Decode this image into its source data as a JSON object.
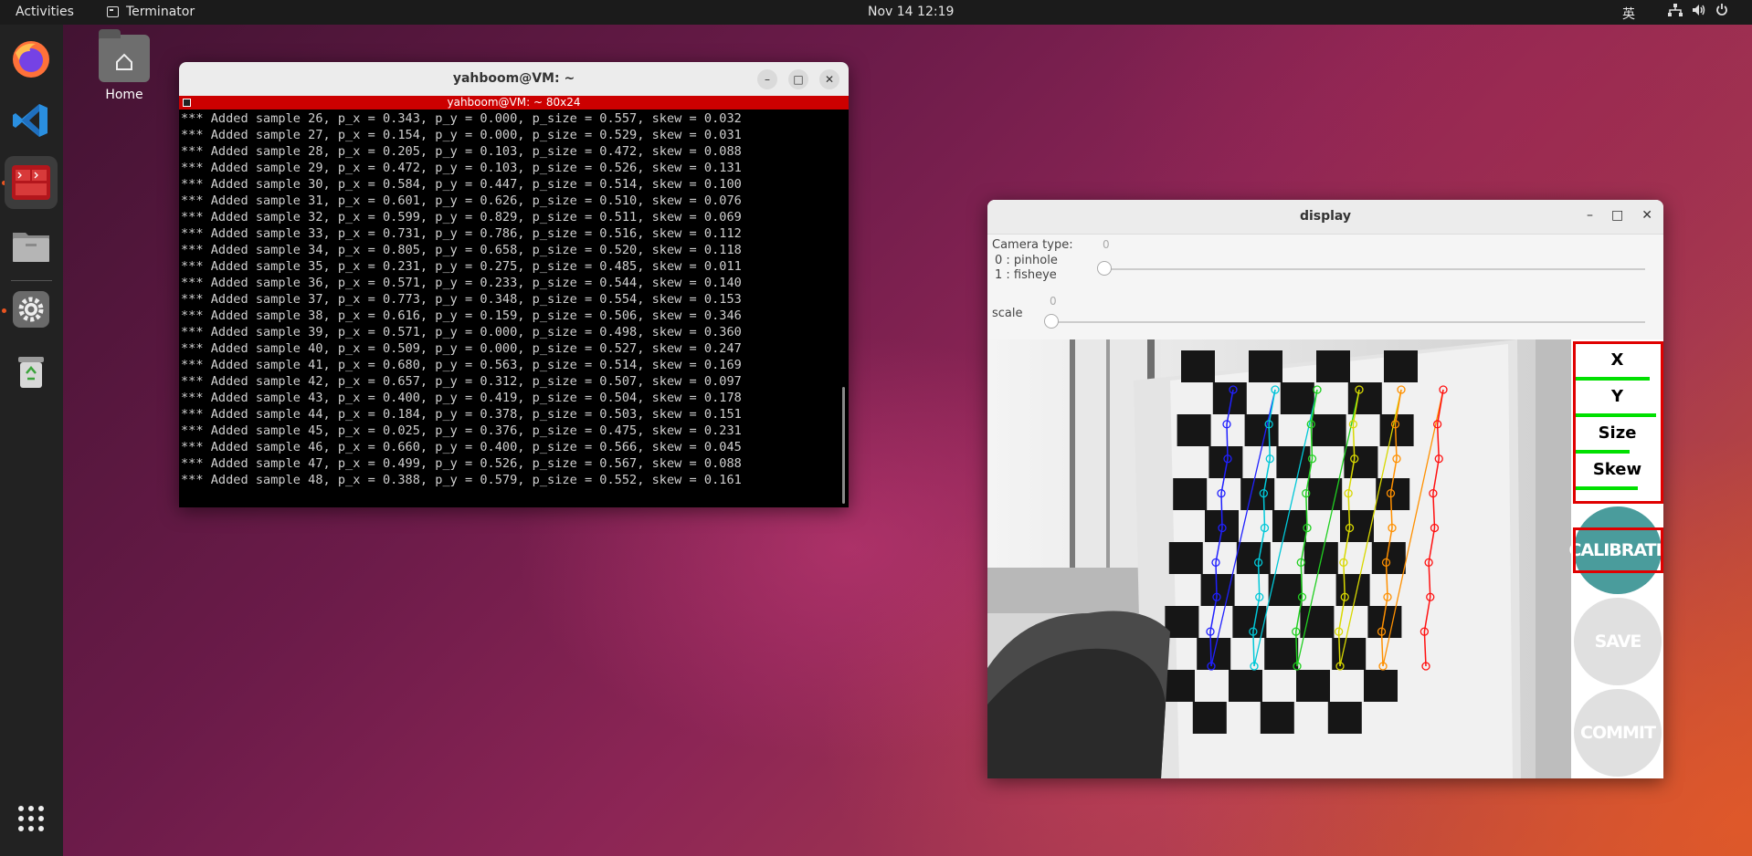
{
  "topbar": {
    "activities": "Activities",
    "app_name": "Terminator",
    "clock": "Nov 14  12:19",
    "ime": "英"
  },
  "dock": {
    "items": [
      {
        "name": "firefox",
        "icon": "firefox-icon"
      },
      {
        "name": "vscode",
        "icon": "vscode-icon"
      },
      {
        "name": "terminator",
        "icon": "terminator-icon",
        "active": true
      },
      {
        "name": "files",
        "icon": "files-icon"
      },
      {
        "name": "settings",
        "icon": "settings-icon"
      },
      {
        "name": "trash",
        "icon": "trash-icon"
      },
      {
        "name": "apps",
        "icon": "app-grid-icon"
      }
    ]
  },
  "desktop": {
    "home_label": "Home"
  },
  "terminal": {
    "title": "yahboom@VM: ~",
    "tab_title": "yahboom@VM: ~ 80x24",
    "lines": [
      "*** Added sample 26, p_x = 0.343, p_y = 0.000, p_size = 0.557, skew = 0.032",
      "*** Added sample 27, p_x = 0.154, p_y = 0.000, p_size = 0.529, skew = 0.031",
      "*** Added sample 28, p_x = 0.205, p_y = 0.103, p_size = 0.472, skew = 0.088",
      "*** Added sample 29, p_x = 0.472, p_y = 0.103, p_size = 0.526, skew = 0.131",
      "*** Added sample 30, p_x = 0.584, p_y = 0.447, p_size = 0.514, skew = 0.100",
      "*** Added sample 31, p_x = 0.601, p_y = 0.626, p_size = 0.510, skew = 0.076",
      "*** Added sample 32, p_x = 0.599, p_y = 0.829, p_size = 0.511, skew = 0.069",
      "*** Added sample 33, p_x = 0.731, p_y = 0.786, p_size = 0.516, skew = 0.112",
      "*** Added sample 34, p_x = 0.805, p_y = 0.658, p_size = 0.520, skew = 0.118",
      "*** Added sample 35, p_x = 0.231, p_y = 0.275, p_size = 0.485, skew = 0.011",
      "*** Added sample 36, p_x = 0.571, p_y = 0.233, p_size = 0.544, skew = 0.140",
      "*** Added sample 37, p_x = 0.773, p_y = 0.348, p_size = 0.554, skew = 0.153",
      "*** Added sample 38, p_x = 0.616, p_y = 0.159, p_size = 0.506, skew = 0.346",
      "*** Added sample 39, p_x = 0.571, p_y = 0.000, p_size = 0.498, skew = 0.360",
      "*** Added sample 40, p_x = 0.509, p_y = 0.000, p_size = 0.527, skew = 0.247",
      "*** Added sample 41, p_x = 0.680, p_y = 0.563, p_size = 0.514, skew = 0.169",
      "*** Added sample 42, p_x = 0.657, p_y = 0.312, p_size = 0.507, skew = 0.097",
      "*** Added sample 43, p_x = 0.400, p_y = 0.419, p_size = 0.504, skew = 0.178",
      "*** Added sample 44, p_x = 0.184, p_y = 0.378, p_size = 0.503, skew = 0.151",
      "*** Added sample 45, p_x = 0.025, p_y = 0.376, p_size = 0.475, skew = 0.231",
      "*** Added sample 46, p_x = 0.660, p_y = 0.400, p_size = 0.566, skew = 0.045",
      "*** Added sample 47, p_x = 0.499, p_y = 0.526, p_size = 0.567, skew = 0.088",
      "*** Added sample 48, p_x = 0.388, p_y = 0.579, p_size = 0.552, skew = 0.161"
    ]
  },
  "display": {
    "title": "display",
    "camera_type_label": "Camera type:",
    "camera_type_value": "0",
    "option_pinhole": "0 : pinhole",
    "option_fisheye": "1 : fisheye",
    "scale_label": "scale",
    "scale_value": "0",
    "progress": {
      "x_label": "X",
      "y_label": "Y",
      "size_label": "Size",
      "skew_label": "Skew",
      "x_fill": 0.9,
      "y_fill": 0.98,
      "size_fill": 0.65,
      "skew_fill": 0.75
    },
    "buttons": {
      "calibrate": "CALIBRATE",
      "save": "SAVE",
      "commit": "COMMIT"
    },
    "colors": {
      "calibrate_bg": "#4a9c9c",
      "disabled_bg": "#e0e0e0",
      "highlight": "#e00000",
      "bar": "#00e000"
    }
  }
}
